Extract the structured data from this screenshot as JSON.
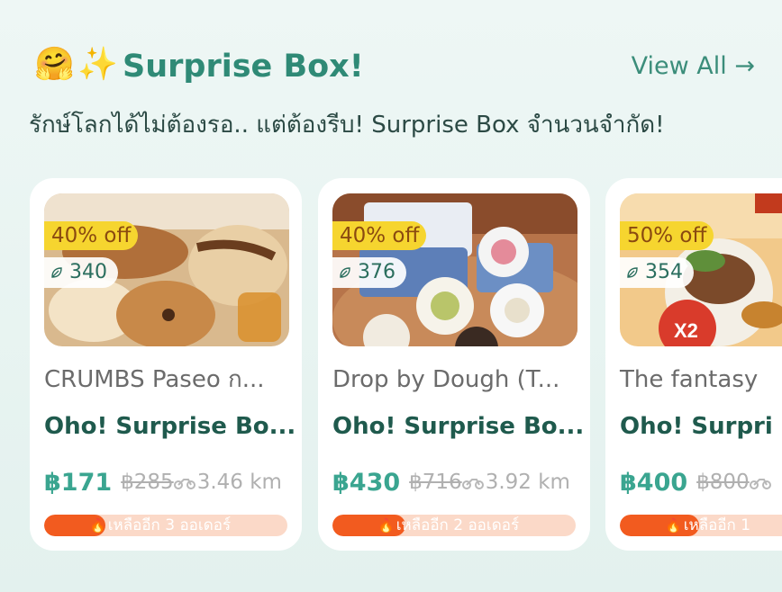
{
  "section": {
    "title": "Surprise Box!",
    "emoji_hug": "🤗",
    "emoji_sparkles": "✨",
    "view_all": "View All →",
    "subtitle": "รักษ์โลกได้ไม่ต้องรอ.. แต่ต้องรีบ! Surprise Box จำนวนจำกัด!"
  },
  "cards": [
    {
      "discount": "40% off",
      "points": "340",
      "store": "CRUMBS Paseo ก...",
      "product": "Oho! Surprise Bo...",
      "price": "฿171",
      "original_price": "฿285",
      "distance": "3.46 km",
      "stock_text": "เหลืออีก 3 ออเดอร์",
      "stock_level": 0.25
    },
    {
      "discount": "40% off",
      "points": "376",
      "store": "Drop by Dough (T...",
      "product": "Oho! Surprise Bo...",
      "price": "฿430",
      "original_price": "฿716",
      "distance": "3.92 km",
      "stock_text": "เหลืออีก 2 ออเดอร์",
      "stock_level": 0.3
    },
    {
      "discount": "50% off",
      "points": "354",
      "store": "The fantasy",
      "product": "Oho! Surpri",
      "price": "฿400",
      "original_price": "฿800",
      "distance": "",
      "stock_text": "เหลืออีก 1",
      "stock_level": 0.45
    }
  ],
  "colors": {
    "accent": "#2f8a76",
    "price": "#3aa590",
    "discount_badge": "#f6d52f",
    "stock_fill": "#f25b1f",
    "stock_track": "#fbd9c8"
  },
  "icons": [
    "leaf-icon",
    "motorbike-icon",
    "fire-icon",
    "arrow-right-icon"
  ]
}
